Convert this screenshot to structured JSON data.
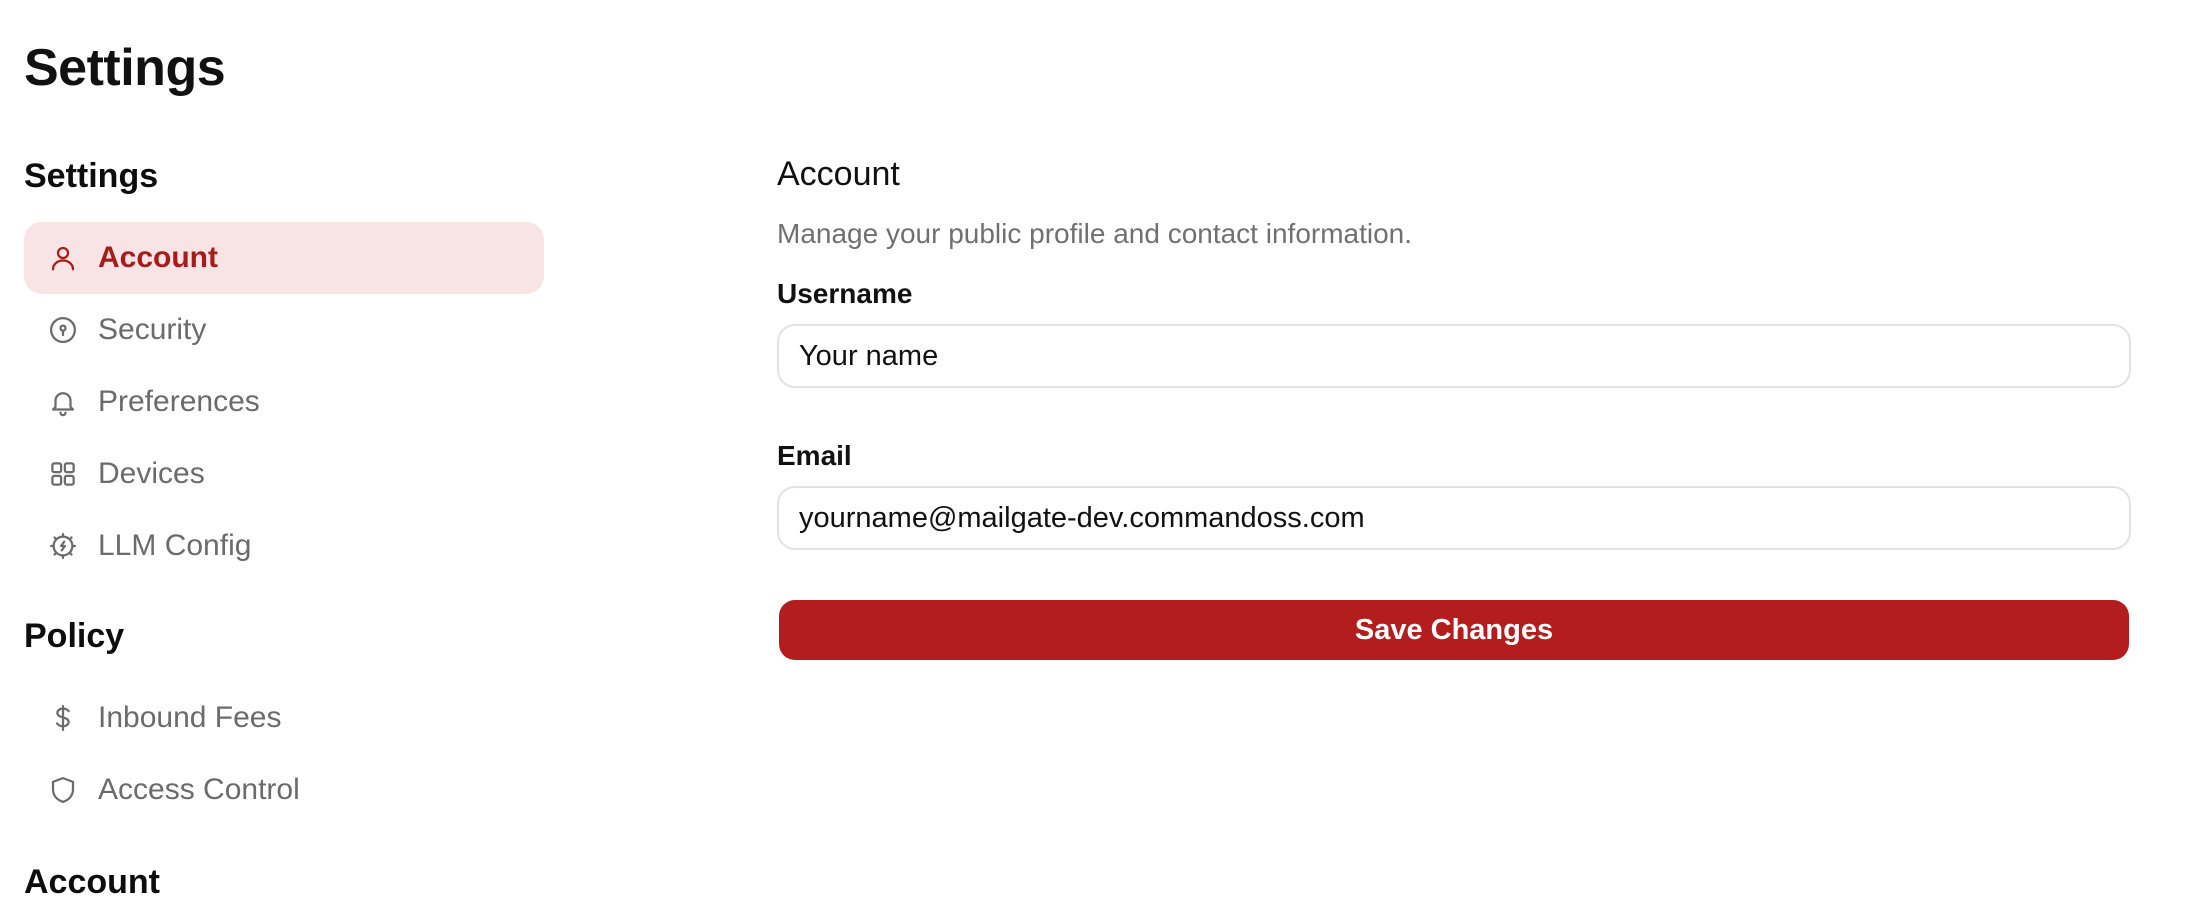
{
  "page": {
    "title": "Settings"
  },
  "sidebar": {
    "settings_heading": "Settings",
    "settings_items": [
      {
        "label": "Account",
        "icon": "user-icon",
        "active": true
      },
      {
        "label": "Security",
        "icon": "keyhole-icon"
      },
      {
        "label": "Preferences",
        "icon": "bell-icon"
      },
      {
        "label": "Devices",
        "icon": "grid-icon"
      },
      {
        "label": "LLM Config",
        "icon": "cpu-badge-icon"
      }
    ],
    "policy_heading": "Policy",
    "policy_items": [
      {
        "label": "Inbound Fees",
        "icon": "dollar-icon"
      },
      {
        "label": "Access Control",
        "icon": "shield-icon"
      }
    ],
    "account_heading": "Account"
  },
  "main": {
    "title": "Account",
    "description": "Manage your public profile and contact information.",
    "username_label": "Username",
    "username_value": "Your name",
    "email_label": "Email",
    "email_value": "yourname@mailgate-dev.commandoss.com",
    "save_label": "Save Changes"
  },
  "colors": {
    "accent": "#b31d1d",
    "active_bg": "#f8e4e4",
    "active_text": "#a61b1b",
    "muted_text": "#6b6b6b"
  }
}
